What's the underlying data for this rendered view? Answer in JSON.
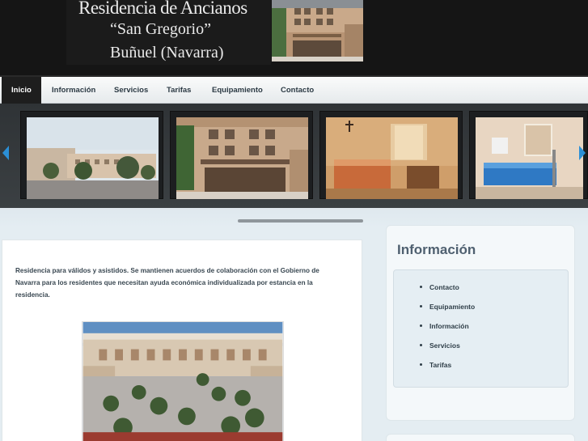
{
  "header": {
    "title": "Residencia de Ancianos",
    "subtitle": "“San Gregorio”",
    "place": "Buñuel (Navarra)"
  },
  "nav": {
    "items": [
      {
        "label": "Inicio"
      },
      {
        "label": "Información"
      },
      {
        "label": "Servicios"
      },
      {
        "label": "Tarifas"
      },
      {
        "label": "Equipamiento"
      },
      {
        "label": "Contacto"
      }
    ]
  },
  "slider": {
    "prev_icon": "chevron-left-icon",
    "next_icon": "chevron-right-icon",
    "accent": "#2b8fd6"
  },
  "main": {
    "intro": "Residencia para válidos y asistidos. Se mantienen acuerdos de colaboración con el Gobierno de Navarra para los residentes que necesitan ayuda económica individualizada por estancia en la residencia."
  },
  "sidebar": {
    "title": "Información",
    "links": [
      {
        "label": "Contacto"
      },
      {
        "label": "Equipamiento"
      },
      {
        "label": "Información"
      },
      {
        "label": "Servicios"
      },
      {
        "label": "Tarifas"
      }
    ]
  }
}
